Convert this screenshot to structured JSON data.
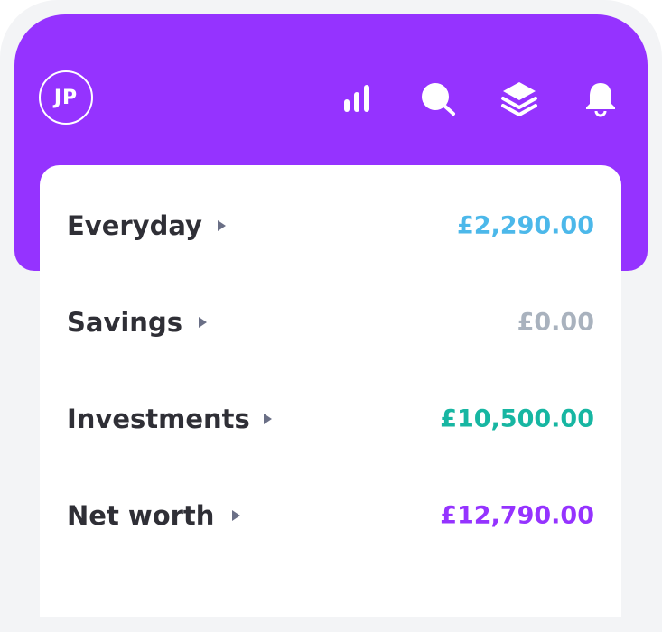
{
  "header": {
    "avatar_initials": "JP",
    "icons": [
      "bar-chart-icon",
      "search-icon",
      "layers-icon",
      "bell-icon"
    ],
    "color": "#9533ff"
  },
  "accounts": [
    {
      "label": "Everyday",
      "amount": "£2,290.00",
      "color": "#4cb8ea"
    },
    {
      "label": "Savings",
      "amount": "£0.00",
      "color": "#a9b2be"
    },
    {
      "label": "Investments",
      "amount": "£10,500.00",
      "color": "#17b6a2"
    },
    {
      "label": "Net worth",
      "amount": "£12,790.00",
      "color": "#9533ff"
    }
  ]
}
